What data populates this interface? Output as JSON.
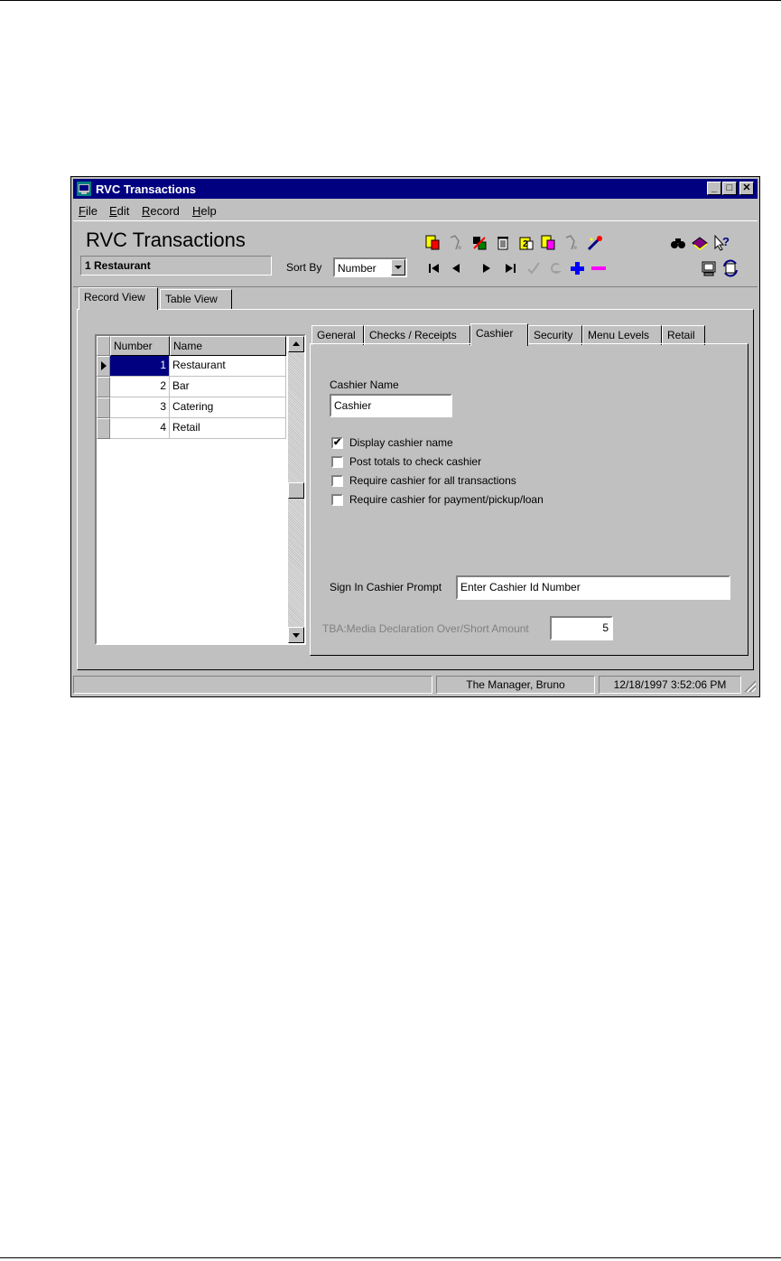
{
  "window": {
    "title": "RVC Transactions",
    "menu": [
      {
        "key": "F",
        "rest": "ile"
      },
      {
        "key": "E",
        "rest": "dit"
      },
      {
        "key": "R",
        "rest": "ecord"
      },
      {
        "key": "H",
        "rest": "elp"
      }
    ],
    "controls": {
      "minimize": "_",
      "maximize": "□",
      "close": "✕"
    }
  },
  "toolbar": {
    "heading": "RVC Transactions",
    "current_record": "1 Restaurant",
    "sort_by_label": "Sort By",
    "sort_by_value": "Number",
    "icons": [
      "add-record-icon",
      "copy-icon",
      "edit-icon",
      "delete-icon",
      "paste-icon",
      "duplicate-icon",
      "undo-icon",
      "wand-icon",
      "find-icon",
      "book-icon",
      "help-icon",
      "first-icon",
      "prev-icon",
      "next-icon",
      "last-icon",
      "confirm-icon",
      "revert-icon",
      "plus-icon",
      "minus-icon",
      "monitor-icon",
      "refresh-icon"
    ]
  },
  "view_tabs": [
    "Record View",
    "Table View"
  ],
  "active_view_tab": 0,
  "grid": {
    "columns": [
      "Number",
      "Name"
    ],
    "rows": [
      {
        "number": "1",
        "name": "Restaurant"
      },
      {
        "number": "2",
        "name": "Bar"
      },
      {
        "number": "3",
        "name": "Catering"
      },
      {
        "number": "4",
        "name": "Retail"
      }
    ],
    "selected_row": 0
  },
  "detail_tabs": [
    "General",
    "Checks / Receipts",
    "Cashier",
    "Security",
    "Menu Levels",
    "Retail"
  ],
  "active_detail_tab": 2,
  "cashier": {
    "name_label": "Cashier Name",
    "name_value": "Cashier",
    "options": [
      {
        "label": "Display cashier name",
        "checked": true,
        "mark": "✔"
      },
      {
        "label": "Post totals to check cashier",
        "checked": false,
        "mark": ""
      },
      {
        "label": "Require cashier for all transactions",
        "checked": false,
        "mark": ""
      },
      {
        "label": "Require cashier for payment/pickup/loan",
        "checked": false,
        "mark": ""
      }
    ],
    "prompt_label": "Sign In Cashier Prompt",
    "prompt_value": "Enter Cashier Id Number",
    "tba_label": "TBA:Media Declaration Over/Short Amount",
    "tba_value": "5"
  },
  "status": {
    "user": "The Manager, Bruno",
    "datetime": "12/18/1997 3:52:06 PM"
  }
}
